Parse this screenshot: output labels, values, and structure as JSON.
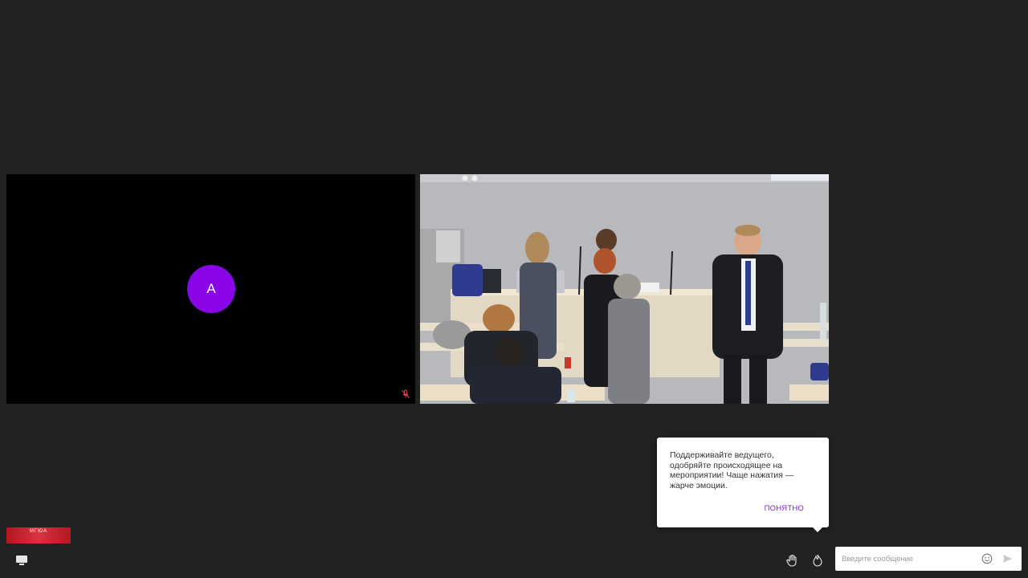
{
  "participant": {
    "initial": "А",
    "avatar_color": "#8a06e8"
  },
  "tooltip": {
    "text": "Поддерживайте ведущего, одобряйте происходящее на мероприятии! Чаще нажатия — жарче эмоции.",
    "button_label": "Понятно"
  },
  "logo": {
    "text": "МГЮА"
  },
  "chat": {
    "placeholder": "Введите сообщение"
  },
  "icons": {
    "mute": "mic-off-icon",
    "screen": "screen-share-icon",
    "hand": "raise-hand-icon",
    "fire": "fire-icon",
    "emoji": "emoji-icon",
    "send": "send-icon"
  },
  "colors": {
    "background": "#222222",
    "accent": "#7b1fc9",
    "mute": "#e0404a"
  }
}
